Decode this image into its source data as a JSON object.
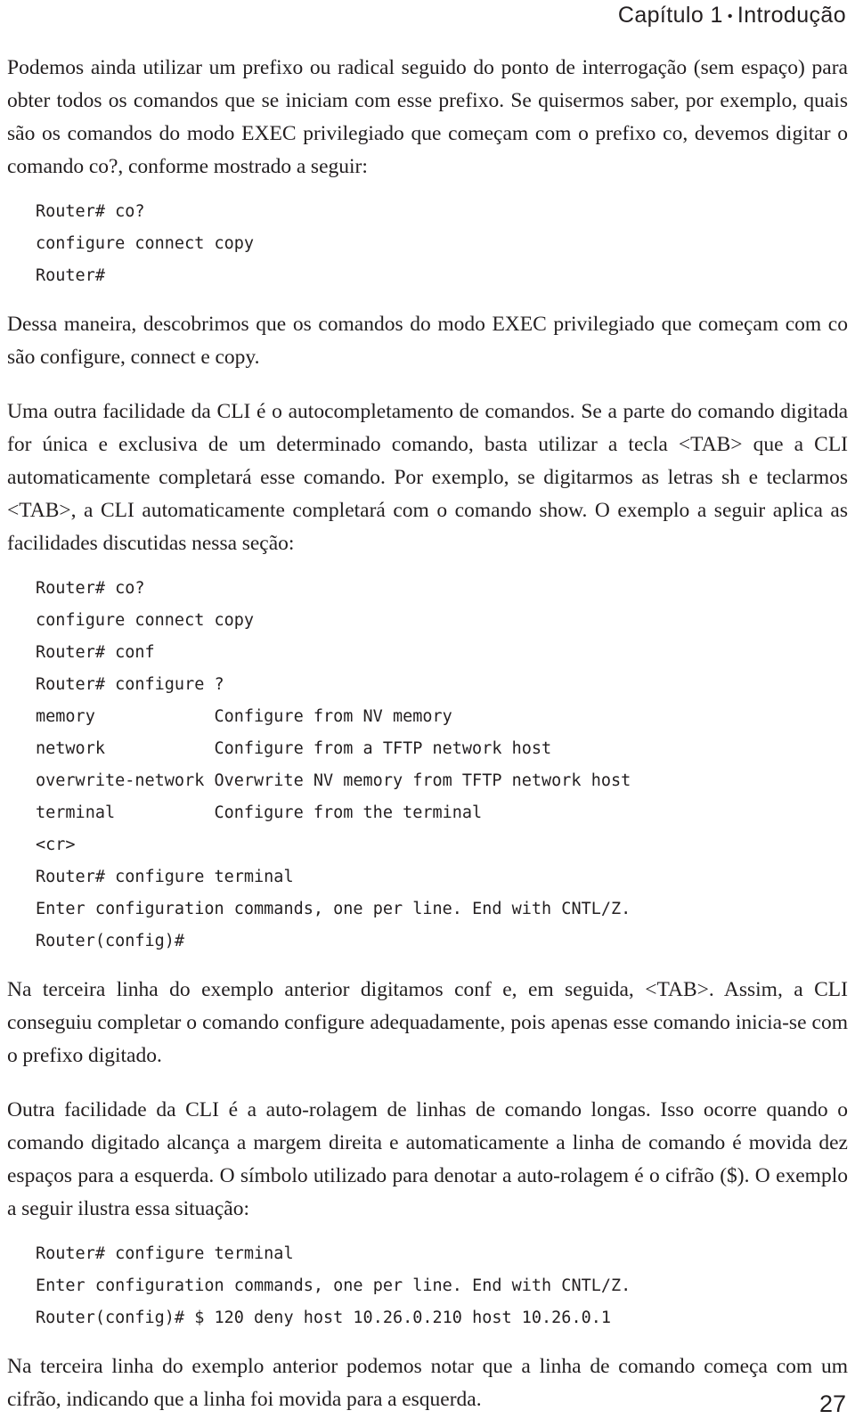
{
  "header": {
    "chapter": "Capítulo 1",
    "separator": "•",
    "title": "Introdução"
  },
  "paragraphs": {
    "p1": "Podemos ainda utilizar um prefixo ou radical seguido do ponto de interrogação (sem espaço) para obter todos os comandos que se iniciam com esse prefixo. Se quisermos saber, por exemplo, quais são os comandos do modo EXEC privilegiado que começam com o prefixo co, devemos digitar o comando co?, conforme mostrado a seguir:",
    "p2": "Dessa maneira, descobrimos que os comandos do modo EXEC privilegiado que começam com co são configure, connect e copy.",
    "p3": "Uma outra facilidade da CLI é o autocompletamento de comandos. Se a parte do comando digitada for única e exclusiva de um determinado comando, basta utilizar a tecla <TAB> que a CLI automaticamente completará esse comando. Por exemplo, se digitarmos as letras sh e teclarmos <TAB>, a CLI automaticamente completará com o comando show. O exemplo a seguir aplica as facilidades discutidas nessa seção:",
    "p4": "Na terceira linha do exemplo anterior digitamos conf e, em seguida, <TAB>. Assim, a CLI conseguiu completar o comando configure adequadamente, pois apenas esse comando inicia-se com o prefixo digitado.",
    "p5": "Outra facilidade da CLI é a auto-rolagem de linhas de comando longas. Isso ocorre quando o comando digitado alcança a margem direita e automaticamente a linha de comando é movida dez espaços para a esquerda. O símbolo utilizado para denotar a auto-rolagem é o cifrão ($). O exemplo a seguir ilustra essa situação:",
    "p6": "Na terceira linha do exemplo anterior podemos notar que a linha de comando começa com um cifrão, indicando que a linha foi movida para a esquerda."
  },
  "code_block_1": {
    "lines": [
      "Router# co?",
      "configure connect copy",
      "Router#"
    ]
  },
  "code_block_2": {
    "lines_before": [
      "Router# co?",
      "configure connect copy",
      "Router# conf",
      "Router# configure ?"
    ],
    "help_entries": [
      {
        "keyword": "memory",
        "description": "Configure from NV memory"
      },
      {
        "keyword": "network",
        "description": "Configure from a TFTP network host"
      },
      {
        "keyword": "overwrite-network",
        "description": "Overwrite NV memory from TFTP network host"
      },
      {
        "keyword": "terminal",
        "description": "Configure from the terminal"
      }
    ],
    "lines_after": [
      "<cr>",
      "Router# configure terminal",
      "Enter configuration commands, one per line. End with CNTL/Z.",
      "Router(config)#"
    ]
  },
  "code_block_3": {
    "lines": [
      "Router# configure terminal",
      "Enter configuration commands, one per line. End with CNTL/Z.",
      "Router(config)# $ 120 deny host 10.26.0.210 host 10.26.0.1"
    ]
  },
  "footer": {
    "page_number": "27"
  }
}
